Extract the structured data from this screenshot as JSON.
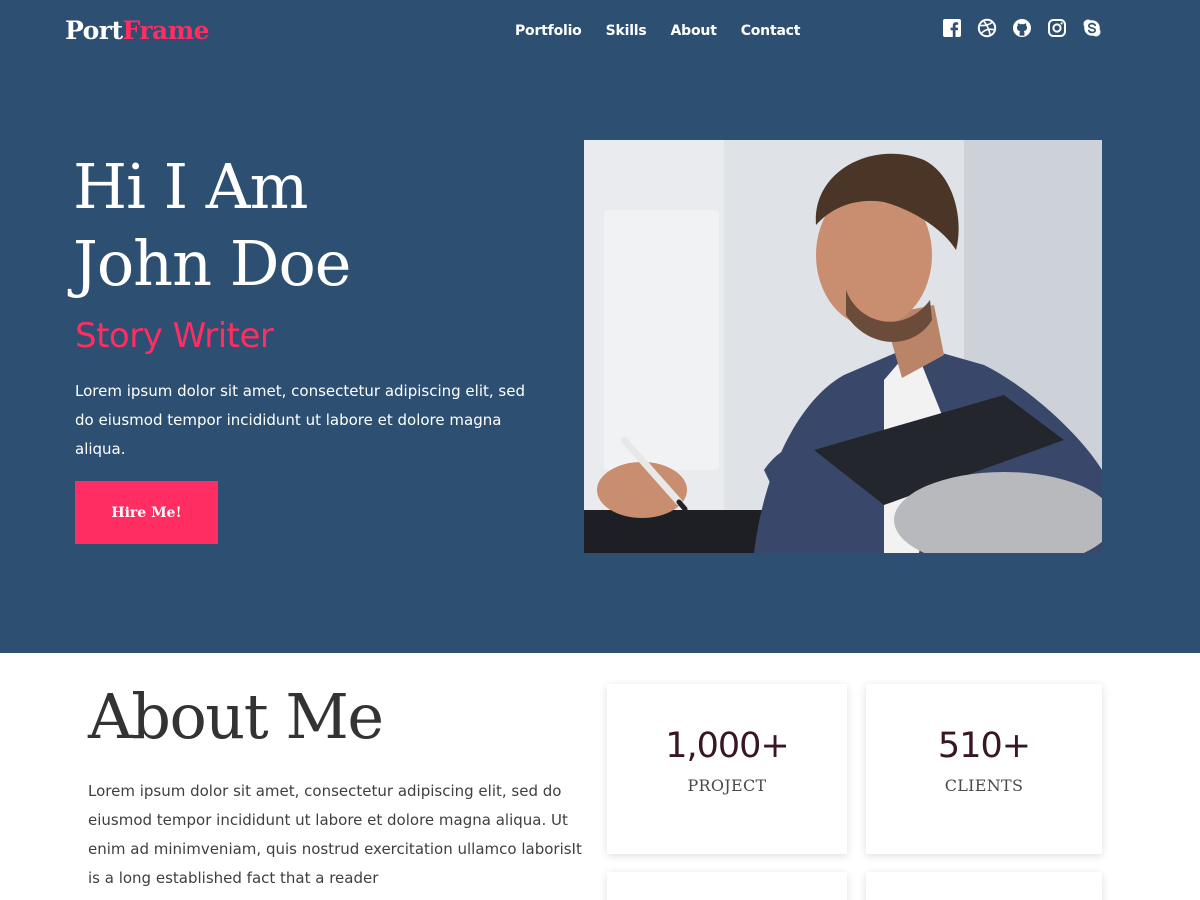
{
  "brand": {
    "part1": "Port",
    "part2": "Frame"
  },
  "nav": [
    {
      "label": "Portfolio"
    },
    {
      "label": "Skills"
    },
    {
      "label": "About"
    },
    {
      "label": "Contact"
    }
  ],
  "social_icons": [
    "facebook-icon",
    "dribbble-icon",
    "github-icon",
    "instagram-icon",
    "skype-icon"
  ],
  "hero": {
    "title_line1": "Hi I Am",
    "title_line2": "John Doe",
    "subtitle": "Story Writer",
    "text": "Lorem ipsum dolor sit amet, consectetur adipiscing elit, sed do eiusmod tempor incididunt ut labore et dolore magna aliqua.",
    "button": "Hire Me!"
  },
  "about": {
    "title": "About Me",
    "text": "Lorem ipsum dolor sit amet, consectetur adipiscing elit, sed do eiusmod tempor incididunt ut labore et dolore magna aliqua. Ut enim ad minimveniam, quis nostrud exercitation ullamco laborisIt is a long established fact that a reader"
  },
  "stats": [
    {
      "value": "1,000+",
      "label": "PROJECT"
    },
    {
      "value": "510+",
      "label": "CLIENTS"
    }
  ],
  "colors": {
    "hero_bg": "#2c4f72",
    "accent": "#ff2d62",
    "stat_number": "#3a1526"
  }
}
